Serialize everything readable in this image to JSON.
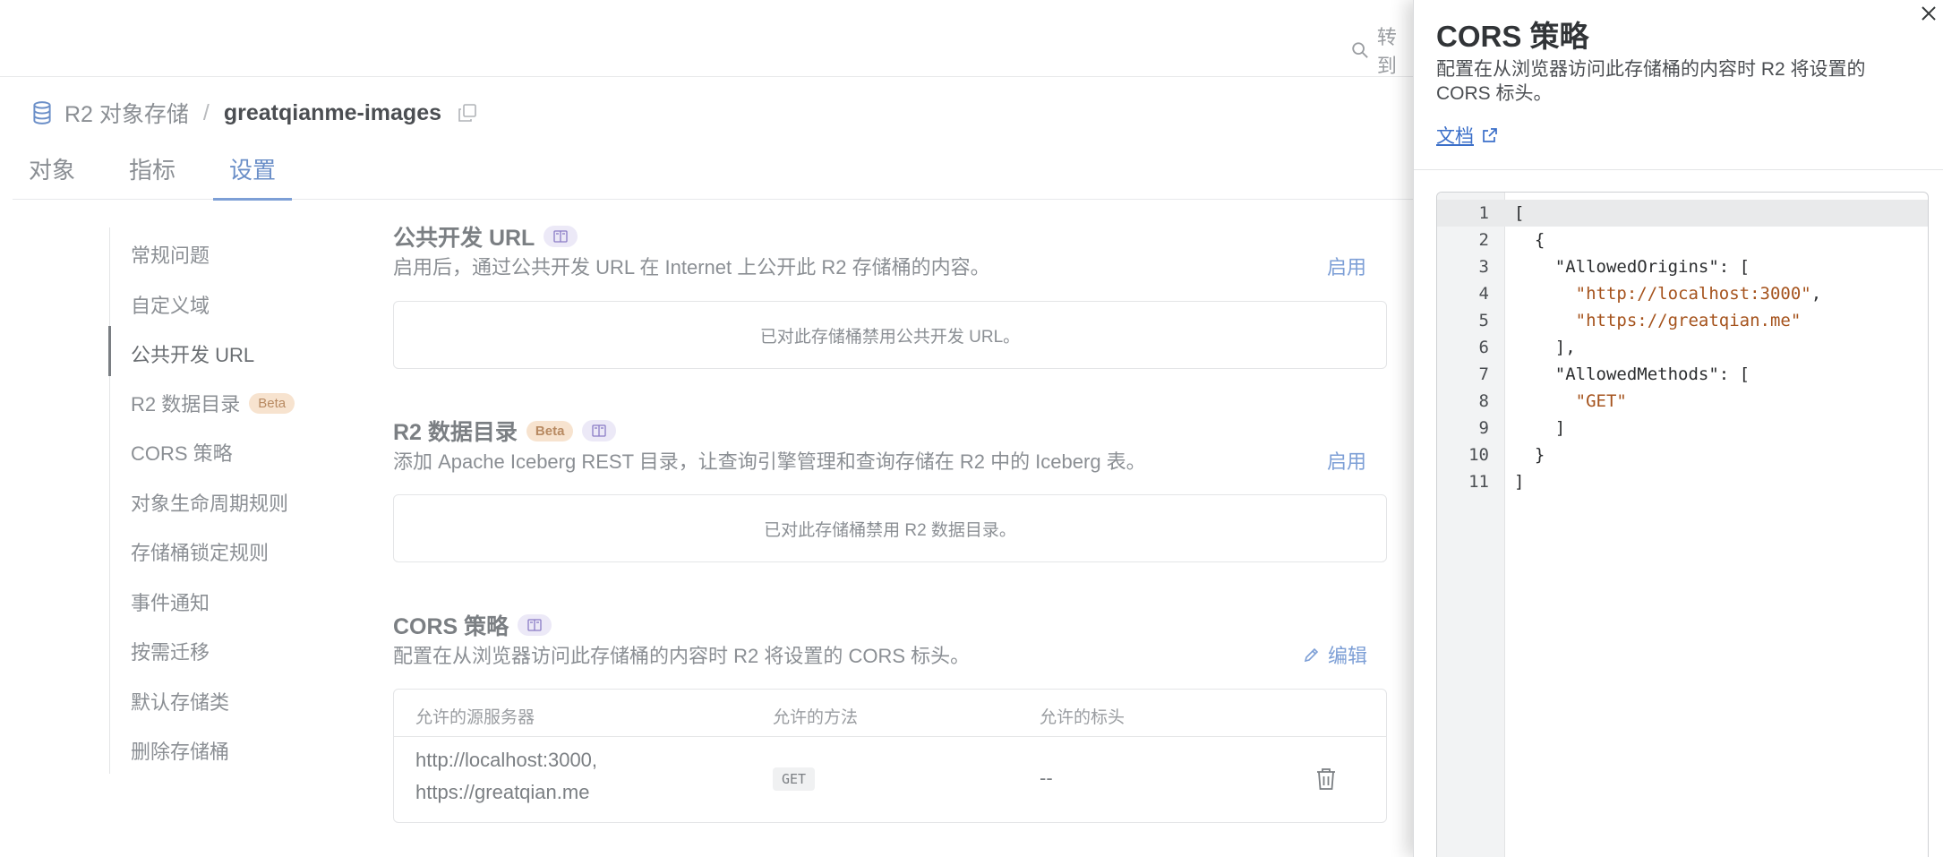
{
  "search": {
    "label": "转到"
  },
  "breadcrumb": {
    "root": "R2 对象存储",
    "separator": "/",
    "bucket": "greatqianme-images"
  },
  "tabs": [
    {
      "label": "对象"
    },
    {
      "label": "指标"
    },
    {
      "label": "设置",
      "active": true
    }
  ],
  "sidenav": {
    "items": [
      {
        "label": "常规问题"
      },
      {
        "label": "自定义域"
      },
      {
        "label": "公共开发 URL",
        "active": true
      },
      {
        "label": "R2 数据目录",
        "badge": "Beta"
      },
      {
        "label": "CORS 策略"
      },
      {
        "label": "对象生命周期规则"
      },
      {
        "label": "存储桶锁定规则"
      },
      {
        "label": "事件通知"
      },
      {
        "label": "按需迁移"
      },
      {
        "label": "默认存储类"
      },
      {
        "label": "删除存储桶"
      }
    ]
  },
  "sections": {
    "public_url": {
      "title": "公共开发 URL",
      "desc": "启用后，通过公共开发 URL 在 Internet 上公开此 R2 存储桶的内容。",
      "action": "启用",
      "empty": "已对此存储桶禁用公共开发 URL。"
    },
    "catalog": {
      "title": "R2 数据目录",
      "badge": "Beta",
      "desc": "添加 Apache Iceberg REST 目录，让查询引擎管理和查询存储在 R2 中的 Iceberg 表。",
      "action": "启用",
      "empty": "已对此存储桶禁用 R2 数据目录。"
    },
    "cors": {
      "title": "CORS 策略",
      "desc": "配置在从浏览器访问此存储桶的内容时 R2 将设置的 CORS 标头。",
      "action": "编辑",
      "table": {
        "headers": [
          "允许的源服务器",
          "允许的方法",
          "允许的标头"
        ],
        "row": {
          "origins_line1": "http://localhost:3000,",
          "origins_line2": "https://greatqian.me",
          "method": "GET",
          "headers": "--"
        }
      }
    }
  },
  "panel": {
    "title": "CORS 策略",
    "desc": "配置在从浏览器访问此存储桶的内容时 R2 将设置的 CORS 标头。",
    "doc_link": "文档",
    "code_lines": [
      {
        "n": "1",
        "pre": "[",
        "str": "",
        "post": ""
      },
      {
        "n": "2",
        "pre": "  {",
        "str": "",
        "post": ""
      },
      {
        "n": "3",
        "pre": "    \"AllowedOrigins\": [",
        "str": "",
        "post": ""
      },
      {
        "n": "4",
        "pre": "      ",
        "str": "\"http://localhost:3000\"",
        "post": ","
      },
      {
        "n": "5",
        "pre": "      ",
        "str": "\"https://greatqian.me\"",
        "post": ""
      },
      {
        "n": "6",
        "pre": "    ],",
        "str": "",
        "post": ""
      },
      {
        "n": "7",
        "pre": "    \"AllowedMethods\": [",
        "str": "",
        "post": ""
      },
      {
        "n": "8",
        "pre": "      ",
        "str": "\"GET\"",
        "post": ""
      },
      {
        "n": "9",
        "pre": "    ]",
        "str": "",
        "post": ""
      },
      {
        "n": "10",
        "pre": "  }",
        "str": "",
        "post": ""
      },
      {
        "n": "11",
        "pre": "]",
        "str": "",
        "post": ""
      }
    ]
  }
}
